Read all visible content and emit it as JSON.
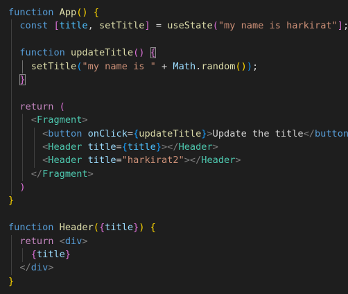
{
  "editor": {
    "language": "javascript-jsx",
    "theme": "dark",
    "lines": [
      [
        [
          "kw",
          "function"
        ],
        [
          "txt",
          " "
        ],
        [
          "fn",
          "App"
        ],
        [
          "b1",
          "()"
        ],
        [
          "txt",
          " "
        ],
        [
          "b1",
          "{"
        ]
      ],
      [
        [
          "txt",
          "  "
        ],
        [
          "kw",
          "const"
        ],
        [
          "txt",
          " "
        ],
        [
          "b2",
          "["
        ],
        [
          "const",
          "title"
        ],
        [
          "txt",
          ", "
        ],
        [
          "fn",
          "setTitle"
        ],
        [
          "b2",
          "]"
        ],
        [
          "txt",
          " = "
        ],
        [
          "fn",
          "useState"
        ],
        [
          "b2",
          "("
        ],
        [
          "str",
          "\"my name is harkirat\""
        ],
        [
          "b2",
          "]"
        ],
        [
          "txt",
          ";"
        ]
      ],
      [
        [
          "txt",
          ""
        ]
      ],
      [
        [
          "txt",
          "  "
        ],
        [
          "kw",
          "function"
        ],
        [
          "txt",
          " "
        ],
        [
          "fn",
          "updateTitle"
        ],
        [
          "b2",
          "()"
        ],
        [
          "txt",
          " "
        ],
        [
          "b2",
          "{"
        ]
      ],
      [
        [
          "txt",
          "    "
        ],
        [
          "fn",
          "setTitle"
        ],
        [
          "b3",
          "("
        ],
        [
          "str",
          "\"my name is \""
        ],
        [
          "txt",
          " + "
        ],
        [
          "var",
          "Math"
        ],
        [
          "txt",
          "."
        ],
        [
          "fn",
          "random"
        ],
        [
          "b1",
          "()"
        ],
        [
          "b3",
          ")"
        ],
        [
          "txt",
          ";"
        ]
      ],
      [
        [
          "txt",
          "  "
        ],
        [
          "b2",
          "}"
        ]
      ],
      [
        [
          "txt",
          ""
        ]
      ],
      [
        [
          "txt",
          "  "
        ],
        [
          "ctrl",
          "return"
        ],
        [
          "txt",
          " "
        ],
        [
          "b2",
          "("
        ]
      ],
      [
        [
          "txt",
          "    "
        ],
        [
          "punc",
          "<"
        ],
        [
          "tag",
          "Fragment"
        ],
        [
          "punc",
          ">"
        ]
      ],
      [
        [
          "txt",
          "      "
        ],
        [
          "punc",
          "<"
        ],
        [
          "kw",
          "button"
        ],
        [
          "txt",
          " "
        ],
        [
          "var",
          "onClick"
        ],
        [
          "txt",
          "="
        ],
        [
          "b3",
          "{"
        ],
        [
          "fn",
          "updateTitle"
        ],
        [
          "b3",
          "}"
        ],
        [
          "punc",
          ">"
        ],
        [
          "txt",
          "Update the title"
        ],
        [
          "punc",
          "</"
        ],
        [
          "kw",
          "button"
        ],
        [
          "punc",
          ">"
        ]
      ],
      [
        [
          "txt",
          "      "
        ],
        [
          "punc",
          "<"
        ],
        [
          "tag",
          "Header"
        ],
        [
          "txt",
          " "
        ],
        [
          "var",
          "title"
        ],
        [
          "txt",
          "="
        ],
        [
          "b3",
          "{"
        ],
        [
          "const",
          "title"
        ],
        [
          "b3",
          "}"
        ],
        [
          "punc",
          "></"
        ],
        [
          "tag",
          "Header"
        ],
        [
          "punc",
          ">"
        ]
      ],
      [
        [
          "txt",
          "      "
        ],
        [
          "punc",
          "<"
        ],
        [
          "tag",
          "Header"
        ],
        [
          "txt",
          " "
        ],
        [
          "var",
          "title"
        ],
        [
          "txt",
          "="
        ],
        [
          "str",
          "\"harkirat2\""
        ],
        [
          "punc",
          "></"
        ],
        [
          "tag",
          "Header"
        ],
        [
          "punc",
          ">"
        ]
      ],
      [
        [
          "txt",
          "    "
        ],
        [
          "punc",
          "</"
        ],
        [
          "tag",
          "Fragment"
        ],
        [
          "punc",
          ">"
        ]
      ],
      [
        [
          "txt",
          "  "
        ],
        [
          "b2",
          ")"
        ]
      ],
      [
        [
          "b1",
          "}"
        ]
      ],
      [
        [
          "txt",
          ""
        ]
      ],
      [
        [
          "kw",
          "function"
        ],
        [
          "txt",
          " "
        ],
        [
          "fn",
          "Header"
        ],
        [
          "b1",
          "("
        ],
        [
          "b2",
          "{"
        ],
        [
          "var",
          "title"
        ],
        [
          "b2",
          "}"
        ],
        [
          "b1",
          ")"
        ],
        [
          "txt",
          " "
        ],
        [
          "b1",
          "{"
        ]
      ],
      [
        [
          "txt",
          "  "
        ],
        [
          "ctrl",
          "return"
        ],
        [
          "txt",
          " "
        ],
        [
          "punc",
          "<"
        ],
        [
          "kw",
          "div"
        ],
        [
          "punc",
          ">"
        ]
      ],
      [
        [
          "txt",
          "    "
        ],
        [
          "b2",
          "{"
        ],
        [
          "var",
          "title"
        ],
        [
          "b2",
          "}"
        ]
      ],
      [
        [
          "txt",
          "  "
        ],
        [
          "punc",
          "</"
        ],
        [
          "kw",
          "div"
        ],
        [
          "punc",
          ">"
        ]
      ],
      [
        [
          "b1",
          "}"
        ]
      ]
    ]
  }
}
